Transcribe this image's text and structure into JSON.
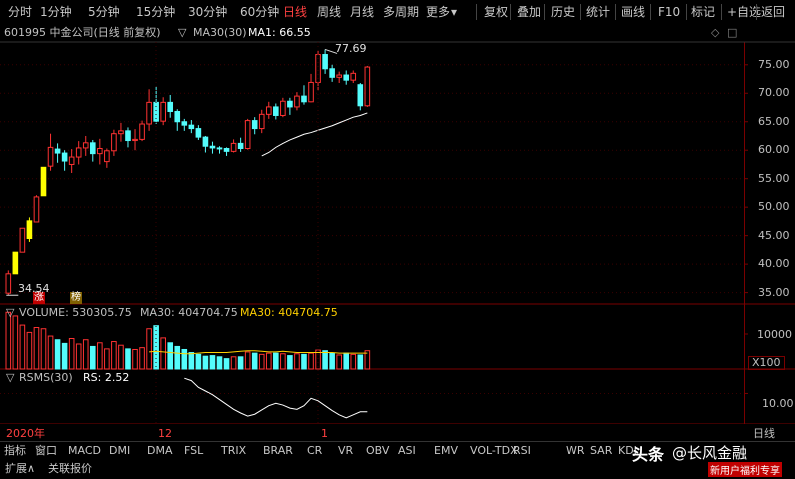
{
  "toolbar": {
    "periods": [
      "分时",
      "1分钟",
      "5分钟",
      "15分钟",
      "30分钟",
      "60分钟",
      "日线",
      "周线",
      "月线",
      "多周期",
      "更多"
    ],
    "active_period": "日线",
    "actions": [
      "复权",
      "叠加",
      "历史",
      "统计",
      "画线",
      "F10",
      "标记",
      "+自选",
      "返回"
    ]
  },
  "header": {
    "stock": "601995 中金公司(日线 前复权)",
    "ma_label": "MA30(30)",
    "ma_value": "MA1: 66.55"
  },
  "price_panel": {
    "y_ticks": [
      "75.00",
      "70.00",
      "65.00",
      "60.00",
      "55.00",
      "50.00",
      "45.00",
      "40.00",
      "35.00"
    ],
    "high_annot": "77.69",
    "low_annot": "34.54",
    "tag_zhang": "涨",
    "tag_bang": "榜"
  },
  "volume_panel": {
    "label": "VOLUME: 530305.75",
    "ma_label": "MA30: 404704.75",
    "ma_label2": "MA30: 404704.75",
    "y_tick": "10000",
    "unit": "X100"
  },
  "rsms_panel": {
    "label": "RSMS(30)",
    "rs_value": "RS: 2.52",
    "y_tick": "10.00"
  },
  "x_axis": {
    "labels": [
      "2020年",
      "12",
      "1"
    ],
    "period": "日线"
  },
  "indicator_tabs": [
    "指标",
    "窗口",
    "MACD",
    "DMI",
    "DMA",
    "FSL",
    "TRIX",
    "BRAR",
    "CR",
    "VR",
    "OBV",
    "ASI",
    "EMV",
    "VOL-TDX",
    "RSI",
    "WR",
    "SAR",
    "KDJ",
    "CCI",
    "ROC",
    "MTM",
    "BOLL",
    "PSY"
  ],
  "footer": {
    "items": [
      "扩展∧",
      "关联报价"
    ]
  },
  "watermark": {
    "brand": "头条",
    "author": "@长风金融",
    "promo": "新用户福利专享"
  },
  "chart_data": {
    "type": "candlestick",
    "title": "601995 中金公司(日线 前复权)",
    "ylim": [
      33,
      79
    ],
    "candles": [
      {
        "o": 34.9,
        "c": 38.3,
        "h": 38.9,
        "l": 34.54
      },
      {
        "o": 38.3,
        "c": 42.1,
        "h": 42.1,
        "l": 38.3
      },
      {
        "o": 42.1,
        "c": 46.3,
        "h": 46.3,
        "l": 42.1
      },
      {
        "o": 44.5,
        "c": 47.6,
        "h": 48.2,
        "l": 43.9
      },
      {
        "o": 47.4,
        "c": 51.8,
        "h": 52.1,
        "l": 47.4
      },
      {
        "o": 52.0,
        "c": 57.0,
        "h": 57.0,
        "l": 52.0
      },
      {
        "o": 57.2,
        "c": 60.5,
        "h": 62.9,
        "l": 56.4
      },
      {
        "o": 60.2,
        "c": 59.5,
        "h": 61.2,
        "l": 57.8
      },
      {
        "o": 59.5,
        "c": 58.1,
        "h": 60.0,
        "l": 56.4
      },
      {
        "o": 57.5,
        "c": 58.8,
        "h": 60.2,
        "l": 56.0
      },
      {
        "o": 58.8,
        "c": 60.4,
        "h": 61.6,
        "l": 57.5
      },
      {
        "o": 60.4,
        "c": 61.3,
        "h": 62.5,
        "l": 59.0
      },
      {
        "o": 61.3,
        "c": 59.4,
        "h": 61.8,
        "l": 58.0
      },
      {
        "o": 59.4,
        "c": 60.3,
        "h": 62.0,
        "l": 57.5
      },
      {
        "o": 58.0,
        "c": 59.9,
        "h": 60.3,
        "l": 56.9
      },
      {
        "o": 59.9,
        "c": 62.9,
        "h": 63.6,
        "l": 59.0
      },
      {
        "o": 62.9,
        "c": 63.4,
        "h": 64.8,
        "l": 61.5
      },
      {
        "o": 63.4,
        "c": 61.7,
        "h": 64.0,
        "l": 60.5
      },
      {
        "o": 61.7,
        "c": 61.9,
        "h": 63.7,
        "l": 60.0
      },
      {
        "o": 61.9,
        "c": 64.6,
        "h": 65.2,
        "l": 61.6
      },
      {
        "o": 64.6,
        "c": 68.4,
        "h": 70.7,
        "l": 63.4
      },
      {
        "o": 68.4,
        "c": 65.1,
        "h": 71.2,
        "l": 64.6
      },
      {
        "o": 65.1,
        "c": 68.4,
        "h": 69.3,
        "l": 64.4
      },
      {
        "o": 68.4,
        "c": 66.8,
        "h": 69.7,
        "l": 65.7
      },
      {
        "o": 66.8,
        "c": 65.0,
        "h": 67.2,
        "l": 63.4
      },
      {
        "o": 65.0,
        "c": 64.4,
        "h": 65.5,
        "l": 63.4
      },
      {
        "o": 64.4,
        "c": 63.8,
        "h": 65.3,
        "l": 63.0
      },
      {
        "o": 63.8,
        "c": 62.3,
        "h": 64.4,
        "l": 61.8
      },
      {
        "o": 62.3,
        "c": 60.7,
        "h": 62.5,
        "l": 59.6
      },
      {
        "o": 60.7,
        "c": 60.4,
        "h": 61.5,
        "l": 59.4
      },
      {
        "o": 60.4,
        "c": 60.3,
        "h": 60.7,
        "l": 59.4
      },
      {
        "o": 60.3,
        "c": 59.8,
        "h": 60.5,
        "l": 59.0
      },
      {
        "o": 59.8,
        "c": 61.2,
        "h": 61.9,
        "l": 59.6
      },
      {
        "o": 61.2,
        "c": 60.3,
        "h": 62.2,
        "l": 59.7
      },
      {
        "o": 60.3,
        "c": 65.2,
        "h": 65.5,
        "l": 60.1
      },
      {
        "o": 65.2,
        "c": 63.8,
        "h": 65.8,
        "l": 62.8
      },
      {
        "o": 63.8,
        "c": 66.3,
        "h": 67.1,
        "l": 63.0
      },
      {
        "o": 66.3,
        "c": 67.6,
        "h": 68.5,
        "l": 65.5
      },
      {
        "o": 67.6,
        "c": 66.1,
        "h": 68.2,
        "l": 65.4
      },
      {
        "o": 66.1,
        "c": 68.6,
        "h": 69.2,
        "l": 65.8
      },
      {
        "o": 68.6,
        "c": 67.6,
        "h": 69.2,
        "l": 66.2
      },
      {
        "o": 67.6,
        "c": 69.5,
        "h": 70.2,
        "l": 67.0
      },
      {
        "o": 69.5,
        "c": 68.5,
        "h": 71.4,
        "l": 68.0
      },
      {
        "o": 68.5,
        "c": 71.9,
        "h": 73.4,
        "l": 68.4
      },
      {
        "o": 71.9,
        "c": 76.8,
        "h": 77.5,
        "l": 70.4
      },
      {
        "o": 76.8,
        "c": 74.3,
        "h": 77.69,
        "l": 73.4
      },
      {
        "o": 74.3,
        "c": 72.8,
        "h": 75.0,
        "l": 72.0
      },
      {
        "o": 72.8,
        "c": 73.2,
        "h": 73.8,
        "l": 71.8
      },
      {
        "o": 73.2,
        "c": 72.3,
        "h": 74.0,
        "l": 71.5
      },
      {
        "o": 72.3,
        "c": 73.5,
        "h": 74.0,
        "l": 71.8
      },
      {
        "o": 71.5,
        "c": 67.8,
        "h": 71.8,
        "l": 67.0
      },
      {
        "o": 67.8,
        "c": 74.6,
        "h": 74.8,
        "l": 67.6
      }
    ],
    "special_colors": {
      "limit_up": "#ffff00"
    },
    "limit_up_indices": [
      1,
      3,
      5
    ],
    "ma30": {
      "start": 37,
      "values": [
        59.0,
        59.6,
        60.5,
        61.2,
        61.8,
        62.3,
        62.8,
        63.1,
        63.5,
        63.9,
        64.3,
        64.8,
        65.3,
        65.8,
        66.1,
        66.55
      ]
    },
    "volume": [
      0.93,
      0.87,
      0.72,
      0.6,
      0.68,
      0.66,
      0.54,
      0.48,
      0.42,
      0.5,
      0.41,
      0.48,
      0.37,
      0.43,
      0.33,
      0.45,
      0.39,
      0.33,
      0.32,
      0.35,
      0.66,
      0.71,
      0.51,
      0.43,
      0.37,
      0.32,
      0.27,
      0.24,
      0.21,
      0.22,
      0.2,
      0.17,
      0.2,
      0.2,
      0.28,
      0.26,
      0.24,
      0.26,
      0.26,
      0.25,
      0.22,
      0.25,
      0.24,
      0.26,
      0.31,
      0.3,
      0.26,
      0.23,
      0.26,
      0.24,
      0.23,
      0.3
    ],
    "vol_ma30": [
      0.28,
      0.29,
      0.28,
      0.27,
      0.26,
      0.25,
      0.25,
      0.26,
      0.27,
      0.27,
      0.27,
      0.27,
      0.28,
      0.29,
      0.3,
      0.3,
      0.29,
      0.28,
      0.28,
      0.29,
      0.28,
      0.27,
      0.27,
      0.27,
      0.27,
      0.27,
      0.27,
      0.26,
      0.26,
      0.26,
      0.26,
      0.26
    ],
    "rsms": [
      12.5,
      12.1,
      11.0,
      10.4,
      9.8,
      9.0,
      8.2,
      7.4,
      6.8,
      6.3,
      6.6,
      7.3,
      8.0,
      8.4,
      8.1,
      7.6,
      7.4,
      8.0,
      9.2,
      8.8,
      8.0,
      7.2,
      6.5,
      6.0,
      6.5,
      7.0,
      7.0
    ]
  }
}
